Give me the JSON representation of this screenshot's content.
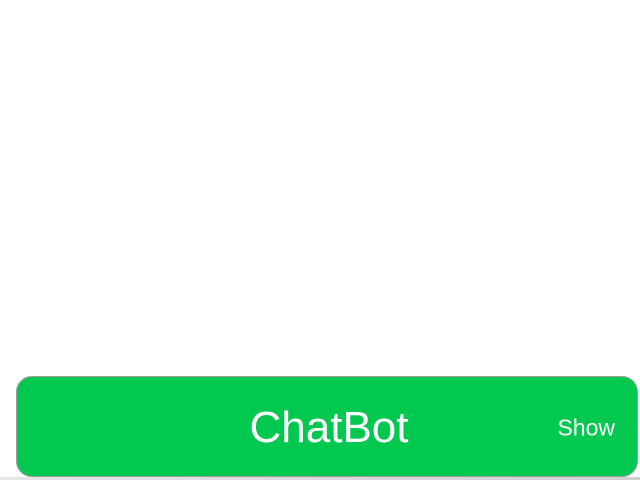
{
  "chatbot": {
    "title": "ChatBot",
    "toggle_label": "Show"
  },
  "colors": {
    "bar_background": "#03c850",
    "bar_text": "#ffffff",
    "page_background": "#ffffff"
  }
}
